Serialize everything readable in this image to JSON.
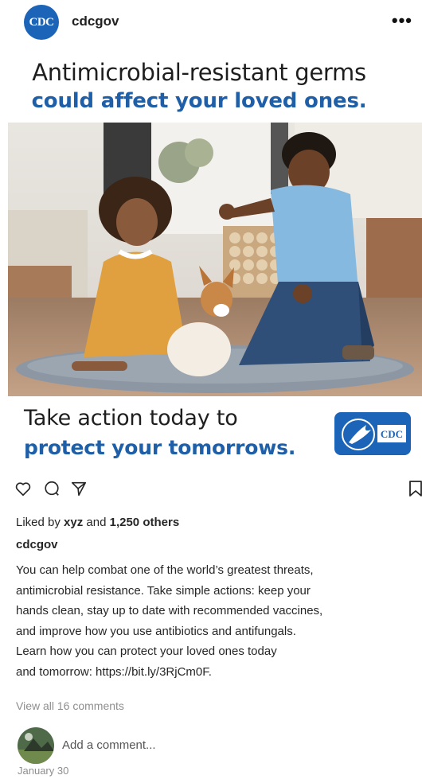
{
  "header": {
    "avatar_text": "CDC",
    "username": "cdcgov",
    "more_label": "•••"
  },
  "media": {
    "headline_line1": "Antimicrobial-resistant germs",
    "headline_line2": "could affect your loved ones.",
    "tagline_line1": "Take action today to",
    "tagline_line2": "protect your tomorrows.",
    "logo_text": "CDC",
    "accent_color": "#1f5fa8",
    "photo_icon": "photo-children-with-puppy"
  },
  "actions": {
    "like_icon": "heart-icon",
    "comment_icon": "comment-icon",
    "share_icon": "share-icon",
    "save_icon": "bookmark-icon"
  },
  "likes": {
    "prefix": "Liked by",
    "user": "xyz",
    "middle": "and",
    "count": "1,250 others"
  },
  "caption": {
    "username": "cdcgov",
    "lines": [
      "You can help combat one of the world’s greatest threats,",
      "antimicrobial resistance. Take simple actions: keep your",
      "hands clean, stay up to date with recommended vaccines,",
      "and improve how you use antibiotics and antifungals.",
      "Learn how you can protect your loved ones today",
      "and tomorrow: https://bit.ly/3RjCm0F."
    ]
  },
  "comments": {
    "view_all": "View all 16 comments",
    "placeholder": "Add a comment..."
  },
  "date": "January 30"
}
